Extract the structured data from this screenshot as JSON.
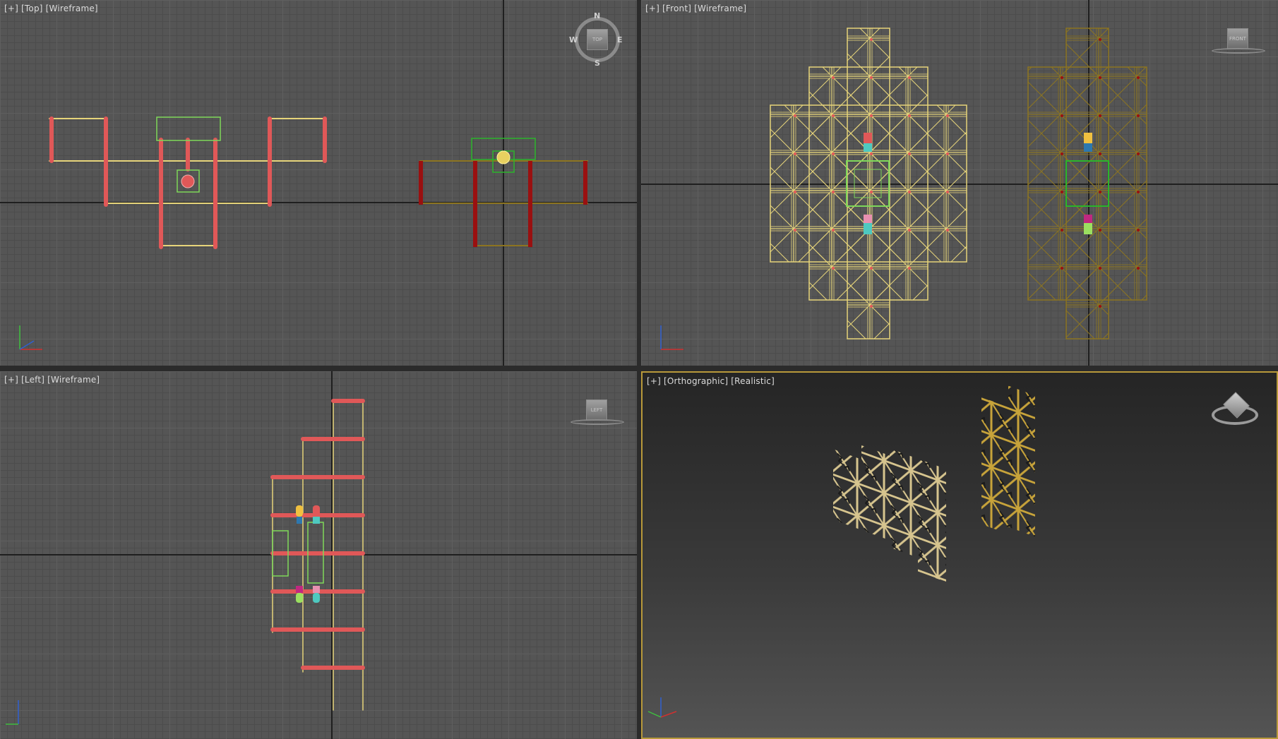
{
  "viewports": {
    "top": {
      "plus": "[+]",
      "view": "[Top]",
      "shading": "[Wireframe]"
    },
    "front": {
      "plus": "[+]",
      "view": "[Front]",
      "shading": "[Wireframe]"
    },
    "left": {
      "plus": "[+]",
      "view": "[Left]",
      "shading": "[Wireframe]"
    },
    "ortho": {
      "plus": "[+]",
      "view": "[Orthographic]",
      "shading": "[Realistic]"
    }
  },
  "compass": {
    "n": "N",
    "s": "S",
    "e": "E",
    "w": "W"
  },
  "viewcube": {
    "top": "TOP",
    "front": "FRONT",
    "left": "LEFT"
  },
  "colors": {
    "grid_bg": "#555555",
    "wire_red": "#e05858",
    "wire_yellow": "#e6d47a",
    "wire_green": "#7ed85a",
    "dark_red": "#9a1010",
    "dark_yellow": "#8c7420",
    "active_border": "#b8993a"
  }
}
